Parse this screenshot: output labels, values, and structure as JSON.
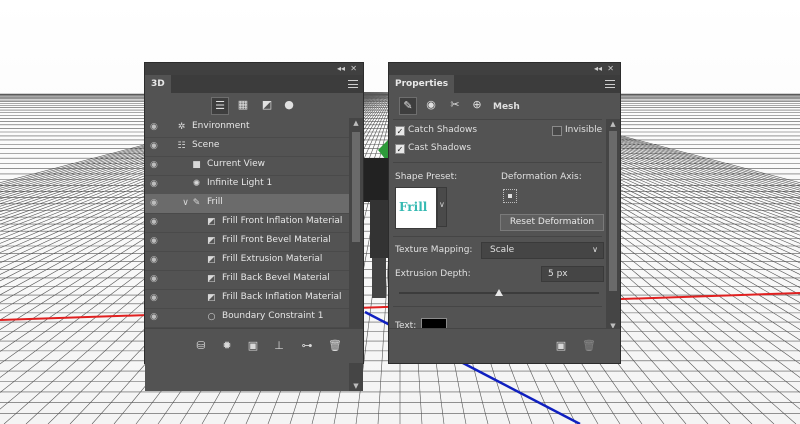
{
  "panel3d": {
    "title": "3D",
    "collapse_glyph": "◂◂",
    "close_glyph": "✕",
    "filters": [
      "whole-scene-icon",
      "meshes-icon",
      "materials-icon",
      "lights-icon"
    ],
    "items": [
      {
        "label": "Environment",
        "icon": "environment-icon",
        "glyph": "✲"
      },
      {
        "label": "Scene",
        "icon": "scene-icon",
        "glyph": "☷"
      },
      {
        "label": "Current View",
        "icon": "camera-icon",
        "glyph": "■"
      },
      {
        "label": "Infinite Light 1",
        "icon": "light-icon",
        "glyph": "✺"
      },
      {
        "label": "Frill",
        "icon": "mesh-icon",
        "glyph": "✎",
        "caret": "∨"
      },
      {
        "label": "Frill Front Inflation Material",
        "icon": "material-icon",
        "glyph": "◩"
      },
      {
        "label": "Frill Front Bevel Material",
        "icon": "material-icon",
        "glyph": "◩"
      },
      {
        "label": "Frill Extrusion Material",
        "icon": "material-icon",
        "glyph": "◩"
      },
      {
        "label": "Frill Back Bevel Material",
        "icon": "material-icon",
        "glyph": "◩"
      },
      {
        "label": "Frill Back Inflation Material",
        "icon": "material-icon",
        "glyph": "◩"
      },
      {
        "label": "Boundary Constraint 1",
        "icon": "constraint-icon",
        "glyph": "○"
      }
    ],
    "footer_buttons": [
      "new-scene-icon",
      "add-light-icon",
      "render-icon",
      "ground-icon",
      "constraint-icon",
      "trash-icon"
    ]
  },
  "properties": {
    "title": "Properties",
    "collapse_glyph": "◂◂",
    "close_glyph": "✕",
    "tab_label": "Mesh",
    "catch_shadows": {
      "label": "Catch Shadows",
      "checked": true
    },
    "cast_shadows": {
      "label": "Cast Shadows",
      "checked": true
    },
    "invisible": {
      "label": "Invisible",
      "checked": false
    },
    "shape_preset_label": "Shape Preset:",
    "shape_preset_thumb_text": "Frill",
    "deformation_axis_label": "Deformation Axis:",
    "reset_button": "Reset Deformation",
    "texture_mapping_label": "Texture Mapping:",
    "texture_mapping_value": "Scale",
    "extrusion_depth_label": "Extrusion Depth:",
    "extrusion_depth_value": "5 px",
    "text_label": "Text:",
    "text_color": "#000000"
  },
  "colors": {
    "panel": "#535353",
    "selected_row": "#6b6b6b",
    "thumb_text": "#35b9b2",
    "axis_red": "#e02020",
    "axis_blue": "#1020c0"
  }
}
